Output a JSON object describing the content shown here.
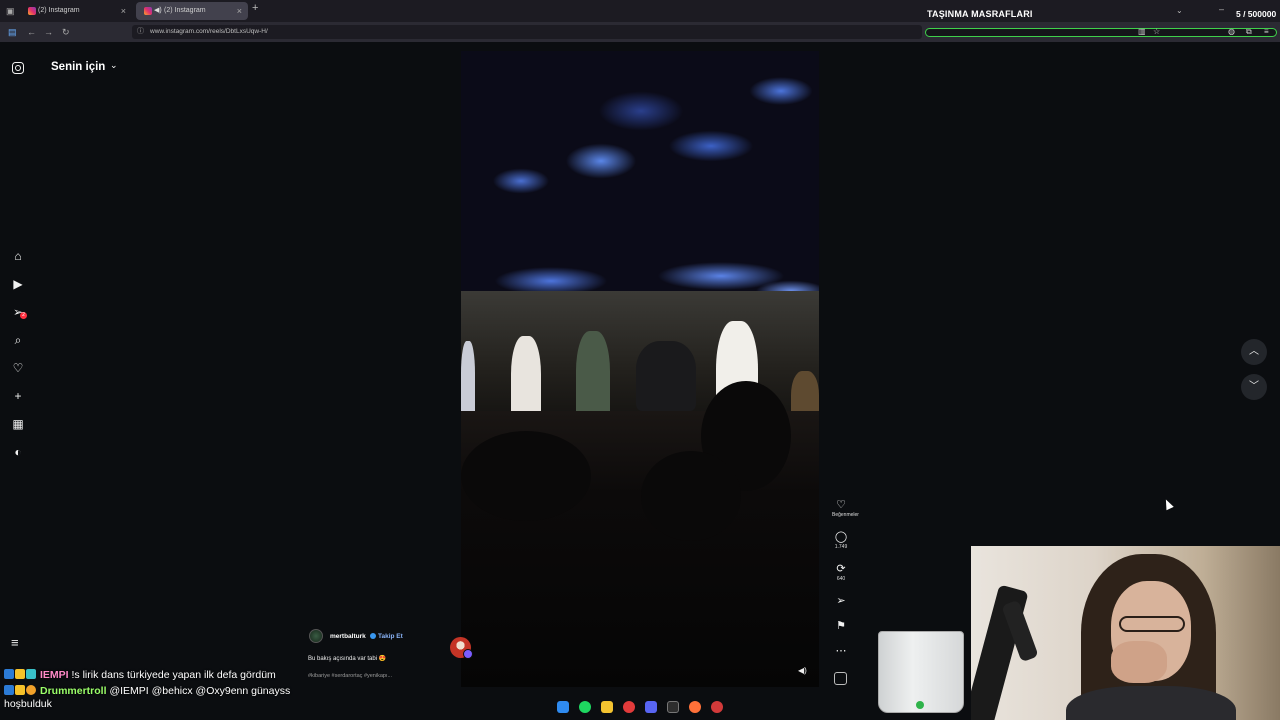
{
  "browser": {
    "tabs": [
      {
        "label": "(2) Instagram",
        "active": false
      },
      {
        "label": "(2) Instagram",
        "active": true
      }
    ],
    "url": "www.instagram.com/reels/DbtLxsUqw-H/"
  },
  "goal_overlay": {
    "title": "TAŞINMA MASRAFLARI",
    "count": "5 / 500000",
    "progress_fraction": 1e-05,
    "accent": "#3fd14b"
  },
  "instagram": {
    "feed_title": "Senin için",
    "nav_icons": [
      "home-icon",
      "reels-icon",
      "messages-icon",
      "search-icon",
      "notifications-icon",
      "create-icon",
      "dashboard-icon",
      "profile-icon"
    ],
    "messages_badge": "2",
    "reel": {
      "author": "mertbalturk",
      "follow_label": "Takip Et",
      "caption": "Bu bakış açısında var tabi 😍",
      "tags": "#kibariye #serdarortaç #yenikapı..."
    },
    "actions": {
      "likes_label": "Beğenmeler",
      "comments_count": "1.749",
      "reposts_count": "640"
    }
  },
  "chat": [
    {
      "user": "IEMPI",
      "message": "!s lirik dans türkiyede yapan ilk defa gördüm"
    },
    {
      "user": "Drummertroll",
      "message": "@IEMPI @behicx @Oxy9enn günayss"
    },
    {
      "user": "",
      "message": "hoşbulduk"
    }
  ],
  "colors": {
    "background": "#0b0d10",
    "instagram_badge": "#ff3040",
    "follow_link": "#8ab4f8"
  }
}
